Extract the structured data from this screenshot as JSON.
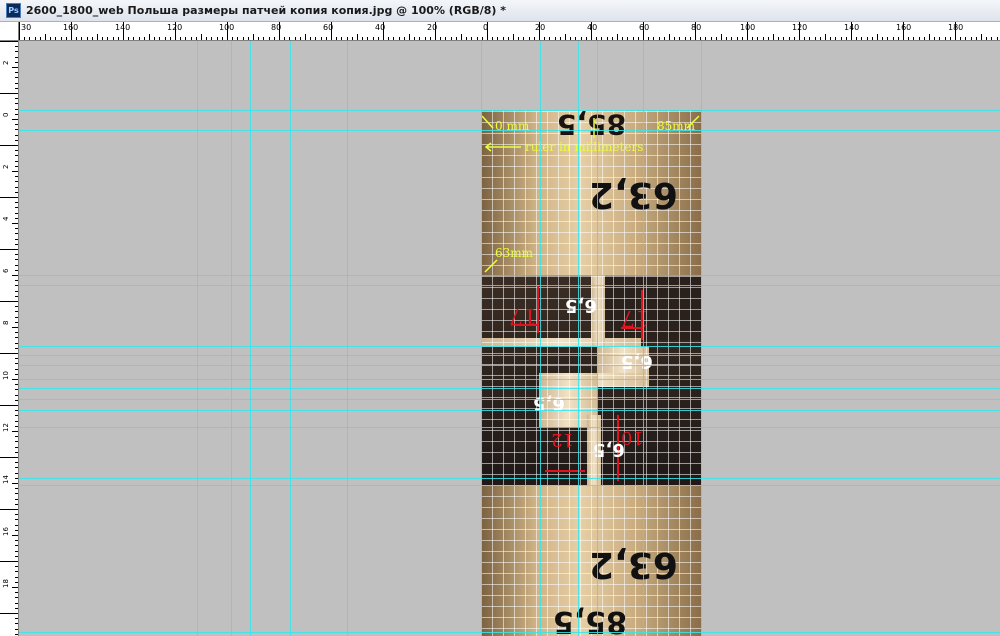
{
  "window": {
    "app_icon": "photoshop-icon",
    "app_icon_text": "Ps",
    "title": "2600_1800_web  Польша размеры патчей копия копия.jpg @ 100% (RGB/8) *"
  },
  "rulers": {
    "horizontal_labels": [
      "30",
      "160",
      "140",
      "120",
      "100",
      "80",
      "60",
      "40",
      "20",
      "0",
      "20",
      "40",
      "60",
      "80",
      "100",
      "120",
      "140",
      "160",
      "180"
    ],
    "vertical_labels": [
      "2",
      "0",
      "2",
      "4",
      "6",
      "8",
      "10",
      "12",
      "14",
      "16",
      "18"
    ]
  },
  "image": {
    "annotations": {
      "zero_mm": "0 mm",
      "eighty_five_mm": "85mm",
      "ruler_note": "ruler in millimeters",
      "sixty_three_mm": "63mm"
    },
    "printed_numbers": {
      "top_width": "85,5",
      "top_height": "63,2",
      "slot_1": "6,5",
      "slot_2": "6,5",
      "slot_3": "6,5",
      "slot_4": "6,5",
      "red_left": "17",
      "red_right": "17",
      "red_bottom_left": "12",
      "red_bottom_right": "10",
      "bottom_height": "63,2",
      "bottom_width": "85,5"
    }
  },
  "colors": {
    "guide": "#33e6ee",
    "annotation": "#e8ff3a",
    "red_marks": "#e0141e",
    "canvas_bg": "#c0c0c0"
  }
}
